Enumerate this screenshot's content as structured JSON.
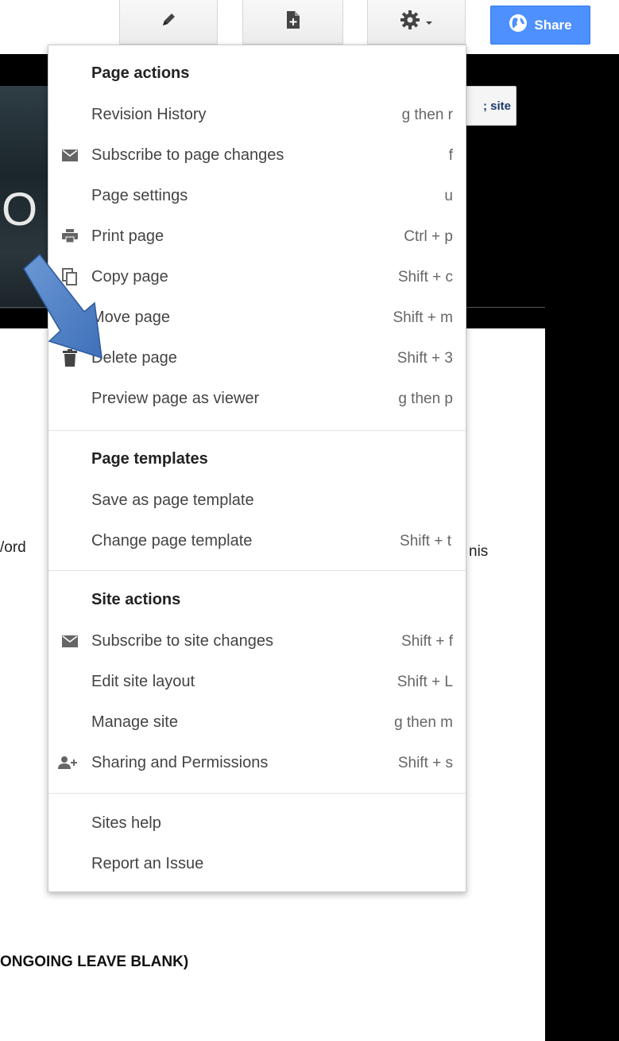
{
  "toolbar": {
    "edit_icon": "pencil-icon",
    "new_page_icon": "new-page-icon",
    "settings_icon": "gear-icon",
    "share_label": "Share"
  },
  "background": {
    "banner_letter": "O",
    "site_button_fragment": "; site",
    "left_fragment": "/ord",
    "right_fragment": "nis",
    "bottom_fragment": "ONGOING LEAVE BLANK)"
  },
  "menu": {
    "page_actions": {
      "heading": "Page actions",
      "items": [
        {
          "label": "Revision History",
          "shortcut": "g then r",
          "icon": ""
        },
        {
          "label": "Subscribe to page changes",
          "shortcut": "f",
          "icon": "envelope-icon"
        },
        {
          "label": "Page settings",
          "shortcut": "u",
          "icon": ""
        },
        {
          "label": "Print page",
          "shortcut": "Ctrl + p",
          "icon": "printer-icon"
        },
        {
          "label": "Copy page",
          "shortcut": "Shift + c",
          "icon": "copy-icon"
        },
        {
          "label": "Move page",
          "shortcut": "Shift + m",
          "icon": ""
        },
        {
          "label": "Delete page",
          "shortcut": "Shift + 3",
          "icon": "trash-icon"
        },
        {
          "label": "Preview page as viewer",
          "shortcut": "g then p",
          "icon": ""
        }
      ]
    },
    "page_templates": {
      "heading": "Page templates",
      "items": [
        {
          "label": "Save as page template",
          "shortcut": ""
        },
        {
          "label": "Change page template",
          "shortcut": "Shift + t"
        }
      ]
    },
    "site_actions": {
      "heading": "Site actions",
      "items": [
        {
          "label": "Subscribe to site changes",
          "shortcut": "Shift + f",
          "icon": "envelope-icon"
        },
        {
          "label": "Edit site layout",
          "shortcut": "Shift + L",
          "icon": ""
        },
        {
          "label": "Manage site",
          "shortcut": "g then m",
          "icon": ""
        },
        {
          "label": "Sharing and Permissions",
          "shortcut": "Shift + s",
          "icon": "add-person-icon"
        }
      ]
    },
    "help": {
      "items": [
        {
          "label": "Sites help"
        },
        {
          "label": "Report an Issue"
        }
      ]
    }
  },
  "colors": {
    "share_blue": "#4d90fe",
    "arrow_blue": "#4a7cc4"
  }
}
